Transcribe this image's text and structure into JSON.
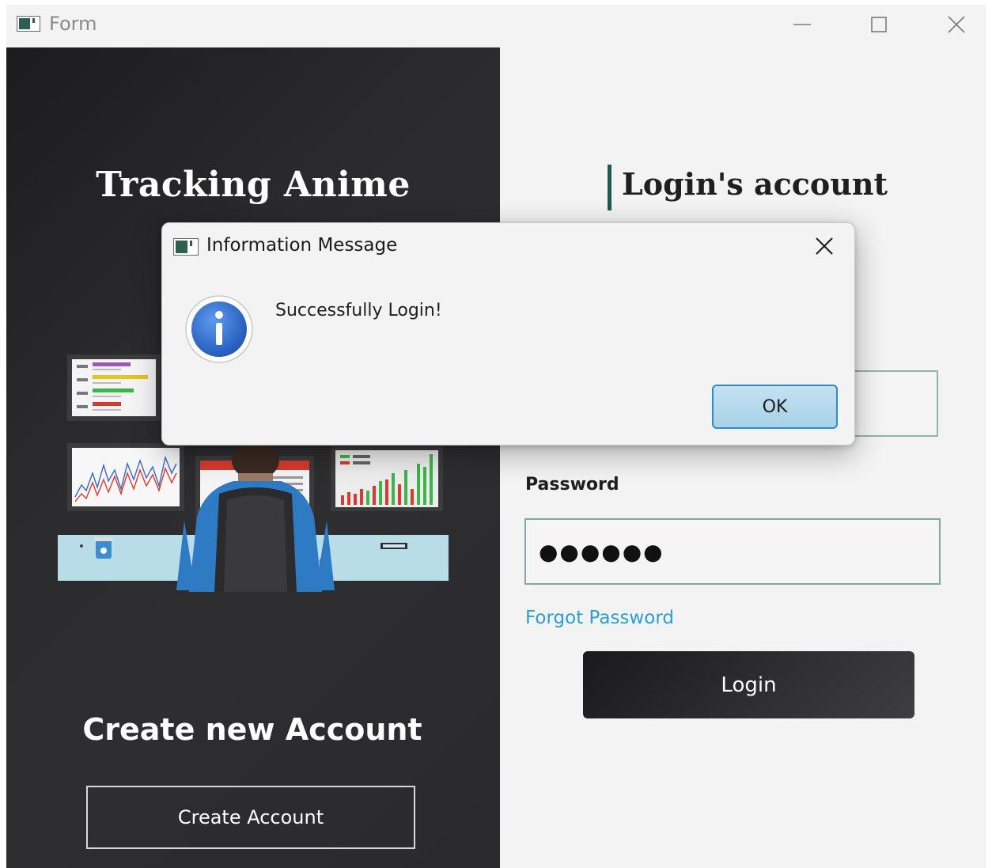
{
  "window": {
    "title": "Form",
    "app_icon": "form-app-icon",
    "controls": [
      "minimize-icon",
      "maximize-icon",
      "close-icon"
    ]
  },
  "left_panel": {
    "brand_title": "Tracking Anime",
    "illustration": "person-at-desk-with-charts-illustration",
    "create_heading": "Create new Account",
    "create_button_label": "Create Account"
  },
  "right_panel": {
    "heading": "Login's account",
    "username_value": "",
    "password_label": "Password",
    "password_value": "●●●●●●",
    "forgot_link": "Forgot Password",
    "login_button_label": "Login"
  },
  "dialog": {
    "title": "Information Message",
    "icon": "information-icon",
    "message": "Successfully Login!",
    "ok_label": "OK"
  },
  "colors": {
    "dark_panel": "#2b2b2d",
    "accent": "#1f5a4c",
    "link": "#2a9fd0",
    "ok_button": "#b6d9ec"
  }
}
